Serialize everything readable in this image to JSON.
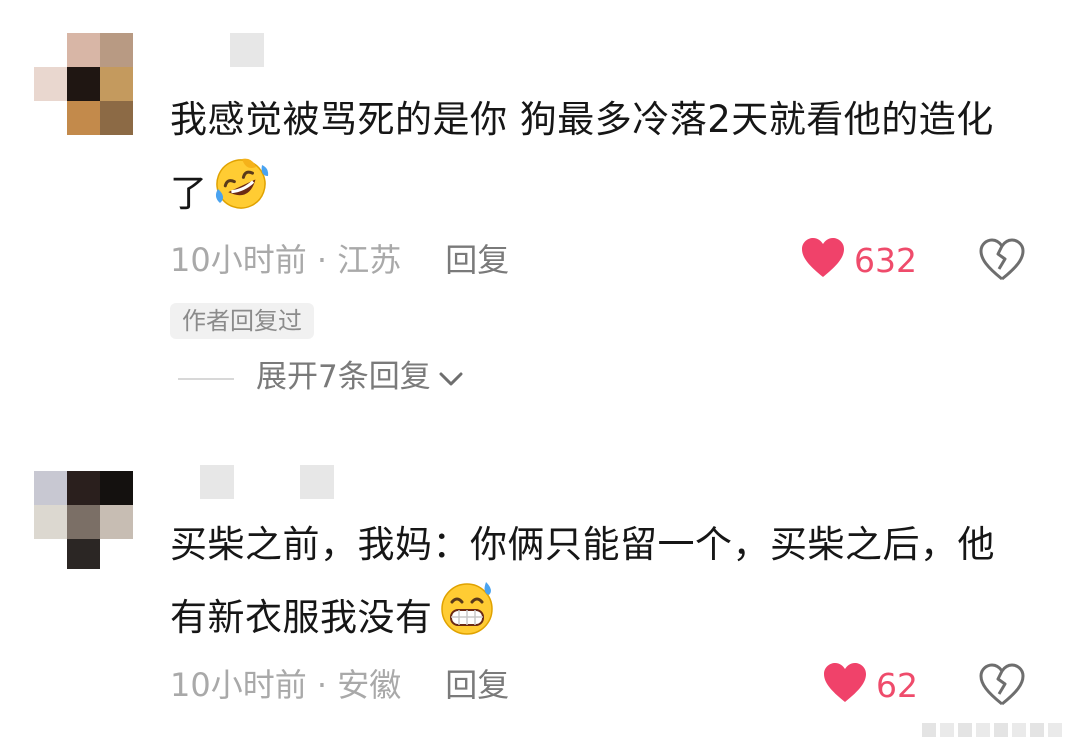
{
  "comments": [
    {
      "text": "我感觉被骂死的是你 狗最多冷落2天就看他的造化了",
      "emoji_icon": "rolling-on-floor-laughing-emoji",
      "time": "10小时前",
      "separator": " · ",
      "location": "江苏",
      "reply_label": "回复",
      "like_count": "632",
      "author_replied_badge": "作者回复过",
      "expand_replies_label": "展开7条回复"
    },
    {
      "text": "买柴之前，我妈：你俩只能留一个，买柴之后，他有新衣服我没有",
      "emoji_icon": "grinning-sweat-emoji",
      "time": "10小时前",
      "separator": " · ",
      "location": "安徽",
      "reply_label": "回复",
      "like_count": "62"
    }
  ],
  "colors": {
    "like_red": "#f0426a",
    "meta_gray": "#a9a9a9",
    "text_dark": "#161616"
  }
}
